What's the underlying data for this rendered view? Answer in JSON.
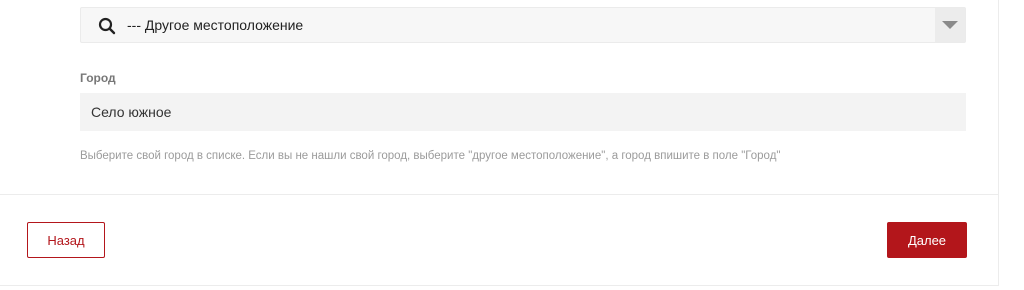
{
  "location": {
    "selected_value": "--- Другое местоположение",
    "icon": "search-icon",
    "dropdown_icon": "chevron-down-icon"
  },
  "city": {
    "label": "Город",
    "value": "Село южное",
    "help_text": "Выберите свой город в списке. Если вы не нашли свой город, выберите \"другое местоположение\", а город впишите в поле \"Город\""
  },
  "footer": {
    "back_label": "Назад",
    "next_label": "Далее"
  },
  "colors": {
    "accent": "#b3161b",
    "field_background": "#f3f3f3",
    "help_text": "#9b9b9b"
  }
}
